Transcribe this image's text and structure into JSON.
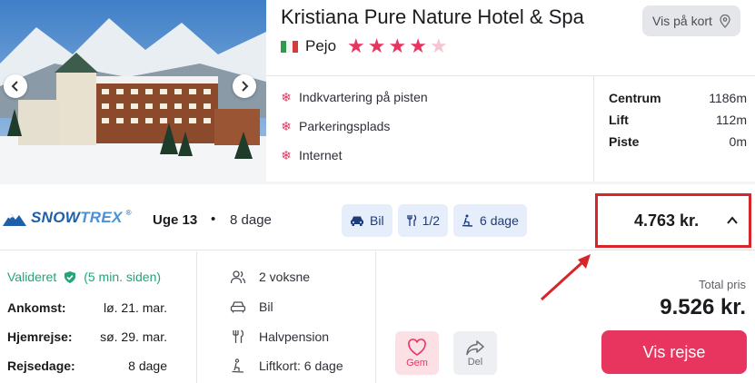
{
  "hotel": {
    "name": "Kristiana Pure Nature Hotel & Spa",
    "map_button": "Vis på kort",
    "location": "Pejo",
    "stars": 4,
    "star_max": 5,
    "amenities": [
      "Indkvartering på pisten",
      "Parkeringsplads",
      "Internet"
    ],
    "distances": [
      {
        "label": "Centrum",
        "value": "1186m"
      },
      {
        "label": "Lift",
        "value": "112m"
      },
      {
        "label": "Piste",
        "value": "0m"
      }
    ]
  },
  "offer": {
    "provider_logo": {
      "part1": "SNOW",
      "part2": "TREX",
      "mark": "®"
    },
    "week": "Uge 13",
    "separator": "•",
    "nights": "8 dage",
    "chips": [
      {
        "icon": "car-icon",
        "label": "Bil"
      },
      {
        "icon": "cutlery-icon",
        "label": "1/2"
      },
      {
        "icon": "ski-lift-icon",
        "label": "6 dage"
      }
    ],
    "price": "4.763 kr."
  },
  "details": {
    "validated": "Valideret",
    "validated_time": "(5 min. siden)",
    "arrival_label": "Ankomst:",
    "arrival_value": "lø. 21. mar.",
    "return_label": "Hjemrejse:",
    "return_value": "sø. 29. mar.",
    "days_label": "Rejsedage:",
    "days_value": "8 dage",
    "features": [
      {
        "icon": "people-icon",
        "label": "2 voksne"
      },
      {
        "icon": "car-icon",
        "label": "Bil"
      },
      {
        "icon": "cutlery-icon",
        "label": "Halvpension"
      },
      {
        "icon": "ski-lift-icon",
        "label": "Liftkort: 6 dage"
      }
    ],
    "save_label": "Gem",
    "share_label": "Del",
    "total_label": "Total pris",
    "total_value": "9.526 kr.",
    "cta_label": "Vis rejse"
  },
  "colors": {
    "accent": "#e8355f",
    "brand_blue": "#1e5fa8",
    "valid_green": "#21a675",
    "highlight_red": "#d6262a"
  }
}
